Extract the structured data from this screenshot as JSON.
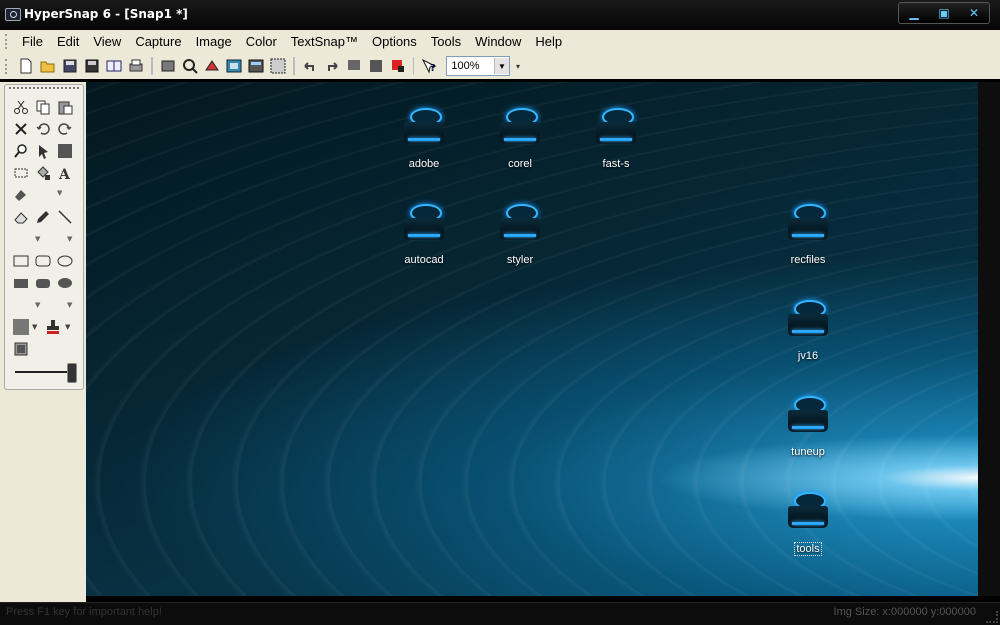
{
  "window": {
    "title": "HyperSnap 6 - [Snap1 *]",
    "buttons": {
      "minimize": "▁",
      "restore": "▣",
      "close": "✕"
    }
  },
  "menu": [
    {
      "label": "File"
    },
    {
      "label": "Edit"
    },
    {
      "label": "View"
    },
    {
      "label": "Capture"
    },
    {
      "label": "Image"
    },
    {
      "label": "Color"
    },
    {
      "label": "TextSnap™"
    },
    {
      "label": "Options"
    },
    {
      "label": "Tools"
    },
    {
      "label": "Window"
    },
    {
      "label": "Help"
    }
  ],
  "toolbar": {
    "zoom_value": "100%",
    "icons": [
      "new-icon",
      "open-icon",
      "save-as-icon",
      "save-icon",
      "print-preview-icon",
      "print-icon",
      "capture-region-icon",
      "capture-object-icon",
      "capture-window-icon",
      "capture-button-icon",
      "capture-full-icon",
      "capture-multi-icon",
      "undo-icon",
      "redo-icon",
      "crop-icon",
      "resize-icon",
      "highlight-icon",
      "help-pointer-icon"
    ]
  },
  "desktop_icons": [
    {
      "label": "adobe"
    },
    {
      "label": "corel"
    },
    {
      "label": "fast-s"
    },
    {
      "label": "autocad"
    },
    {
      "label": "styler"
    },
    {
      "label": "recfiles"
    },
    {
      "label": "jv16"
    },
    {
      "label": "tuneup"
    },
    {
      "label": "tools"
    }
  ],
  "status": {
    "message": "Press F1 key for important help!",
    "image_size": "Img Size:  x:000000  y:000000"
  },
  "colors": {
    "titlebar": "#050505",
    "accent": "#33b6ff",
    "panel": "#ece9d8"
  }
}
